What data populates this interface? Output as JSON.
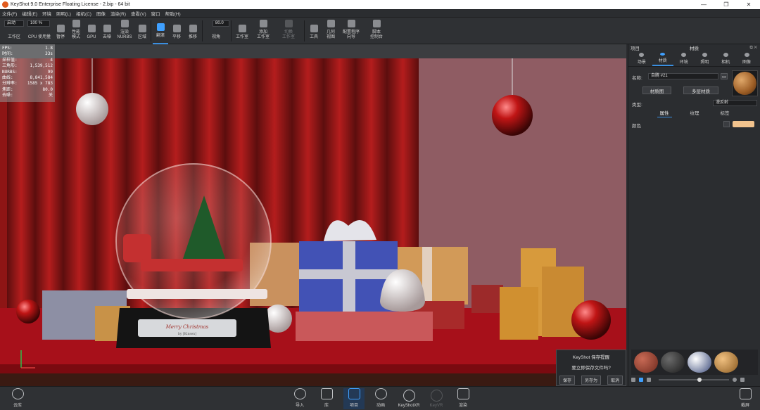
{
  "titlebar": {
    "title": "KeyShot 9.0 Enterprise Floating License  - 2.bip  - 64 bit",
    "minimize": "—",
    "restore": "❐",
    "close": "✕"
  },
  "menu": [
    "文件(F)",
    "编辑(E)",
    "环境",
    "照明(L)",
    "相机(C)",
    "图像",
    "渲染(R)",
    "查看(V)",
    "窗口",
    "帮助(H)"
  ],
  "toolbar": {
    "workspace_value": "启动",
    "workspace_label": "工作区",
    "cpu_value": "100 %",
    "cpu_label": "CPU 使用量",
    "pause": "暂停",
    "perf_mode": "性能\n模式",
    "gpu": "GPU",
    "denoise": "去噪",
    "render_nurbs": "渲染\nNURBS",
    "region": "区域",
    "tumble": "翻滚",
    "pan": "平移",
    "dolly": "推移",
    "fov_value": "80.0",
    "perspective": "视角",
    "studio": "工作室",
    "add_studio": "添加\n工作室",
    "switch_studio": "切换\n工作室",
    "tools": "工具",
    "geometry_view": "几何\n视图",
    "config_wizard": "配置程序\n向导",
    "script_console": "脚本\n控制台"
  },
  "hud": [
    {
      "k": "FPS:",
      "v": "1.8"
    },
    {
      "k": "时间:",
      "v": "33s"
    },
    {
      "k": "采样值:",
      "v": "4"
    },
    {
      "k": "三角形:",
      "v": "1,539,512"
    },
    {
      "k": "NURBS:",
      "v": "99"
    },
    {
      "k": "曲线:",
      "v": "8,841,584"
    },
    {
      "k": "分辨率:",
      "v": "1585 x 783"
    },
    {
      "k": "焦距:",
      "v": "80.0"
    },
    {
      "k": "去噪:",
      "v": "关"
    }
  ],
  "scene": {
    "plaque_text": "Merry Christmas",
    "plaque_sub": "by [Kinsen]"
  },
  "save_dialog": {
    "title": "KeyShot 保存提醒",
    "question": "要立即保存文件吗?",
    "save": "保存",
    "save_as": "另存为",
    "cancel": "取消"
  },
  "right_panel": {
    "project": "项目",
    "header": "材质",
    "tabs": [
      "场景",
      "材质",
      "环境",
      "照明",
      "相机",
      "图像"
    ],
    "name_label": "名称:",
    "name_value": "自腾 #21",
    "material_graph": "材质图",
    "multi_material": "多层材质",
    "type_label": "类型:",
    "type_value": "漫反射",
    "subtabs": [
      "属性",
      "纹理",
      "标签"
    ],
    "color_label": "颜色",
    "color_value": "#f2c38d"
  },
  "bottom": {
    "cloud_library": "云库",
    "import": "导入",
    "library": "库",
    "project": "项目",
    "animation": "动画",
    "keyshotxr": "KeyShotXR",
    "keyvr": "KeyVR",
    "render": "渲染",
    "screenshot": "截屏"
  },
  "colors": {
    "accent": "#3a8fe0",
    "panel": "#2b2d30",
    "toolbar": "#2f3134"
  }
}
